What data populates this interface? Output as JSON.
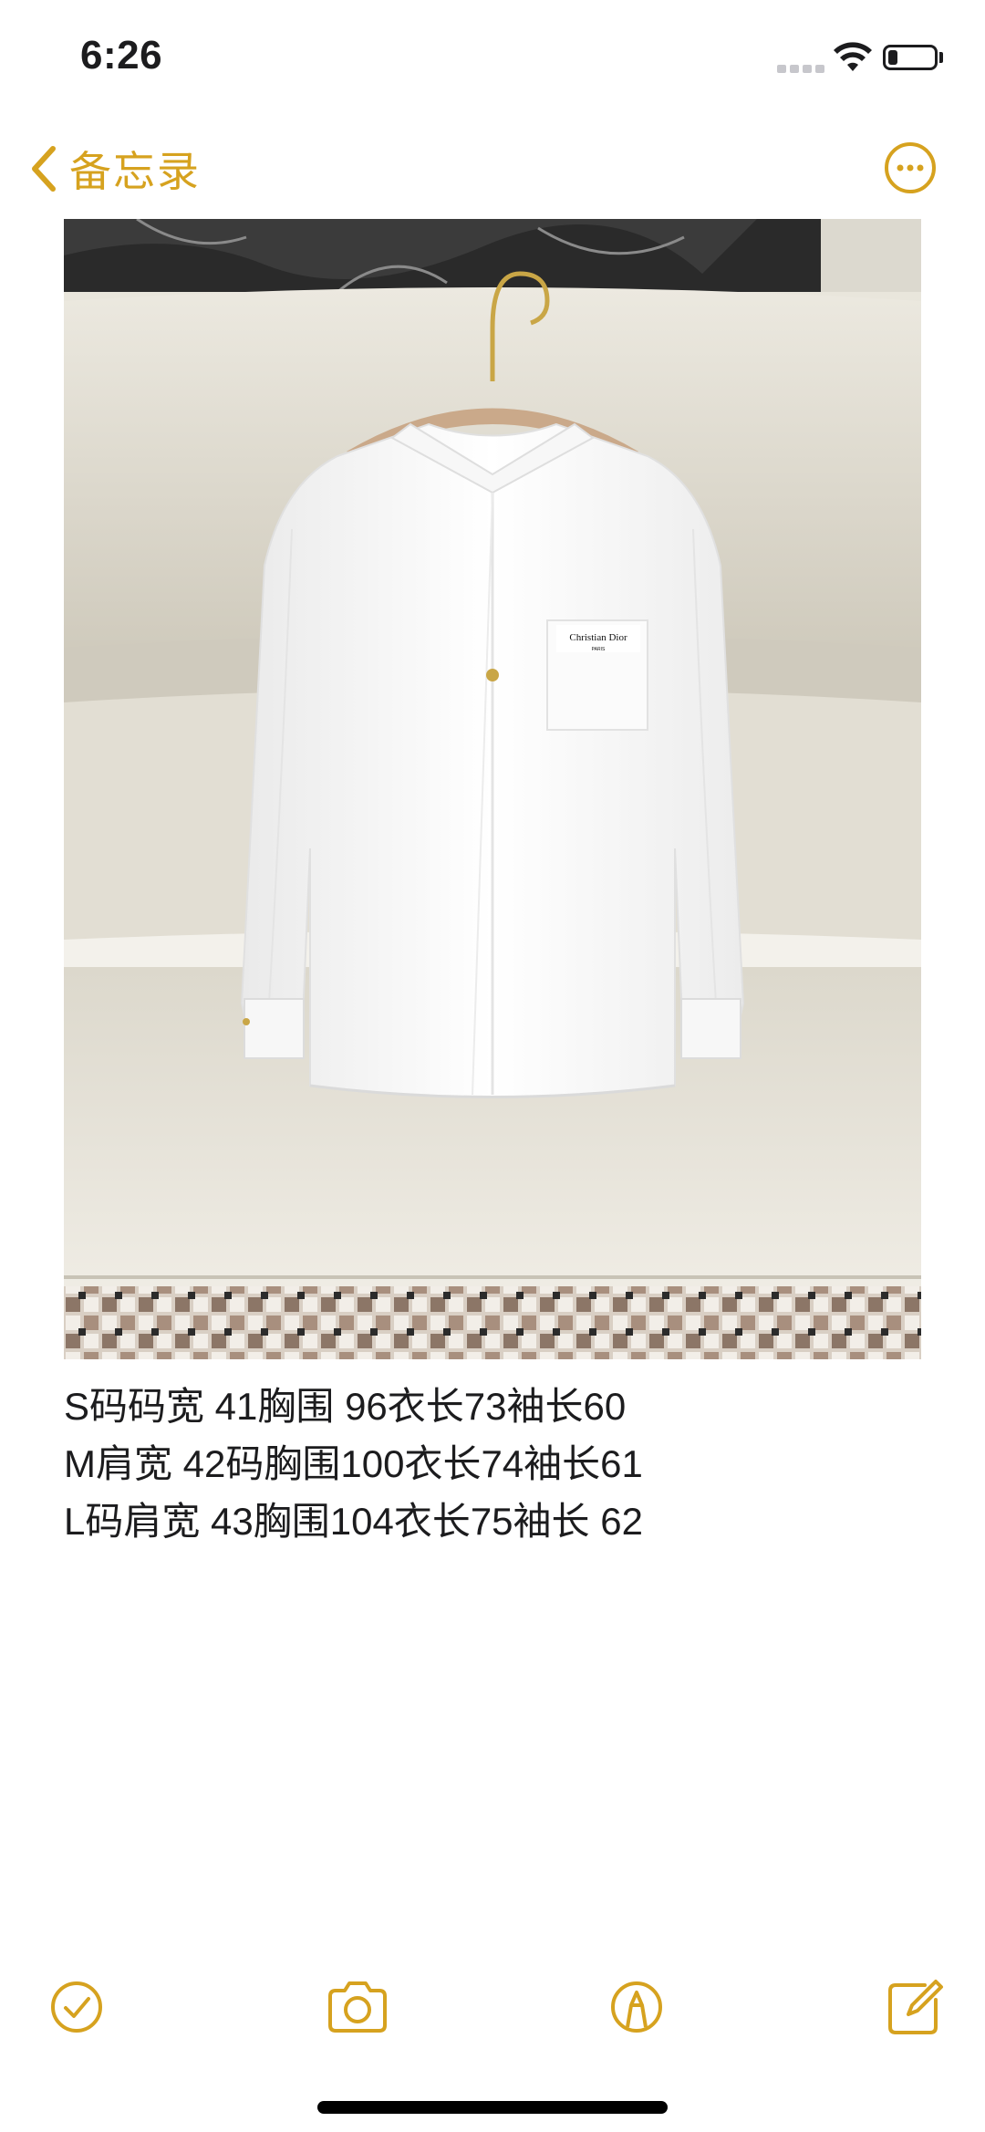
{
  "status_bar": {
    "time": "6:26",
    "battery_level": 0.2
  },
  "nav": {
    "back_label": "备忘录",
    "back_icon": "chevron-left-icon",
    "more_icon": "ellipsis-circle-icon"
  },
  "note": {
    "image": {
      "subject": "white shirt on hanger",
      "embroidery_line1": "Christian Dior",
      "embroidery_line2": "PARIS"
    },
    "lines": [
      "S码码宽 41胸围 96衣长73袖长60",
      "M肩宽 42码胸围100衣长74袖长61",
      "L码肩宽 43胸围104衣长75袖长 62"
    ]
  },
  "toolbar": {
    "items": [
      {
        "icon": "checklist-icon"
      },
      {
        "icon": "camera-icon"
      },
      {
        "icon": "markup-pen-icon"
      },
      {
        "icon": "compose-icon"
      }
    ]
  },
  "colors": {
    "accent": "#d6a21f",
    "text": "#1c1c1e",
    "background": "#ffffff"
  }
}
